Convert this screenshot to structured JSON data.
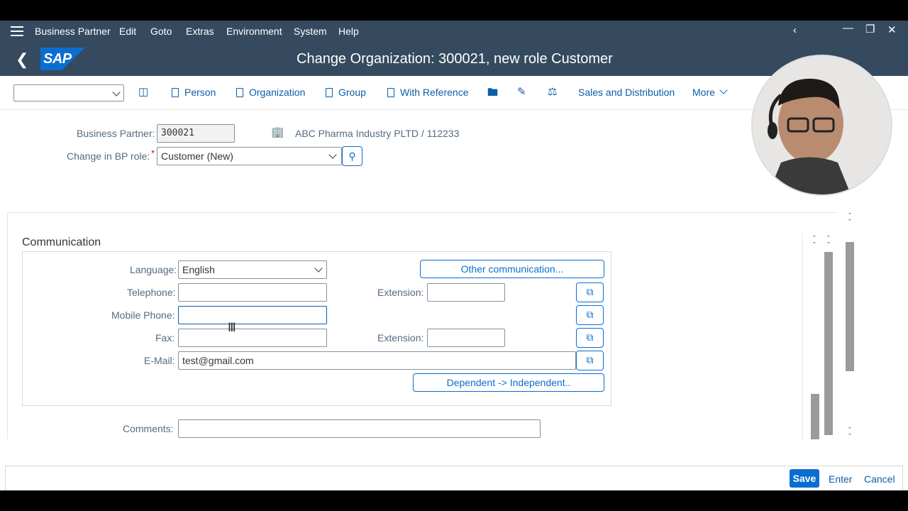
{
  "menu": {
    "items": [
      "Business Partner",
      "Edit",
      "Goto",
      "Extras",
      "Environment",
      "System",
      "Help"
    ]
  },
  "title": "Change Organization: 300021, new role Customer",
  "logo_text": "SAP",
  "toolbar": {
    "select_value": "",
    "person": "Person",
    "organization": "Organization",
    "group": "Group",
    "with_reference": "With Reference",
    "sales_distribution": "Sales and Distribution",
    "more": "More"
  },
  "header": {
    "bp_label": "Business Partner:",
    "bp_value": "300021",
    "bp_description": "ABC Pharma Industry PLTD / 112233",
    "role_label": "Change in BP role:",
    "role_required": "*",
    "role_value": "Customer (New)"
  },
  "communication": {
    "title": "Communication",
    "language_label": "Language:",
    "language_value": "English",
    "other_comm": "Other communication...",
    "telephone_label": "Telephone:",
    "telephone_value": "",
    "extension_label": "Extension:",
    "tel_extension_value": "",
    "mobile_label": "Mobile Phone:",
    "mobile_value": "",
    "fax_label": "Fax:",
    "fax_value": "",
    "fax_extension_value": "",
    "email_label": "E-Mail:",
    "email_value": "test@gmail.com",
    "dependent_btn": "Dependent -> Independent..",
    "comments_label": "Comments:",
    "comments_value": ""
  },
  "footer": {
    "save": "Save",
    "enter": "Enter",
    "cancel": "Cancel"
  },
  "colors": {
    "shell": "#354a5f",
    "accent": "#0a6ed1",
    "link": "#0a5ea8"
  }
}
